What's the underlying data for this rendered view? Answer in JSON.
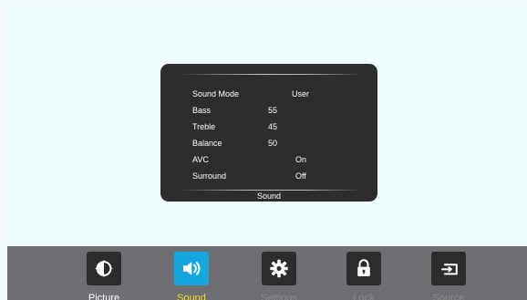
{
  "panel": {
    "title": "Sound",
    "rows": [
      {
        "label": "Sound Mode",
        "value": "User"
      },
      {
        "label": "Bass",
        "value": "55"
      },
      {
        "label": "Treble",
        "value": "45"
      },
      {
        "label": "Balance",
        "value": "50"
      },
      {
        "label": "AVC",
        "value": "On"
      },
      {
        "label": "Surround",
        "value": "Off"
      }
    ]
  },
  "menu": {
    "items": [
      {
        "label": "Picture",
        "icon": "picture-icon",
        "active": false
      },
      {
        "label": "Sound",
        "icon": "sound-icon",
        "active": true
      },
      {
        "label": "Settings",
        "icon": "gear-icon",
        "active": false
      },
      {
        "label": "Lock",
        "icon": "lock-icon",
        "active": false
      },
      {
        "label": "Source",
        "icon": "source-icon",
        "active": false
      }
    ]
  },
  "colors": {
    "screen_background": "#effcfd",
    "panel_background": "#2d2d2d",
    "menu_background": "#6d6f72",
    "active_icon_background": "#13a7dd",
    "active_label": "#f4e01a",
    "inactive_label": "#8b8b8b"
  }
}
